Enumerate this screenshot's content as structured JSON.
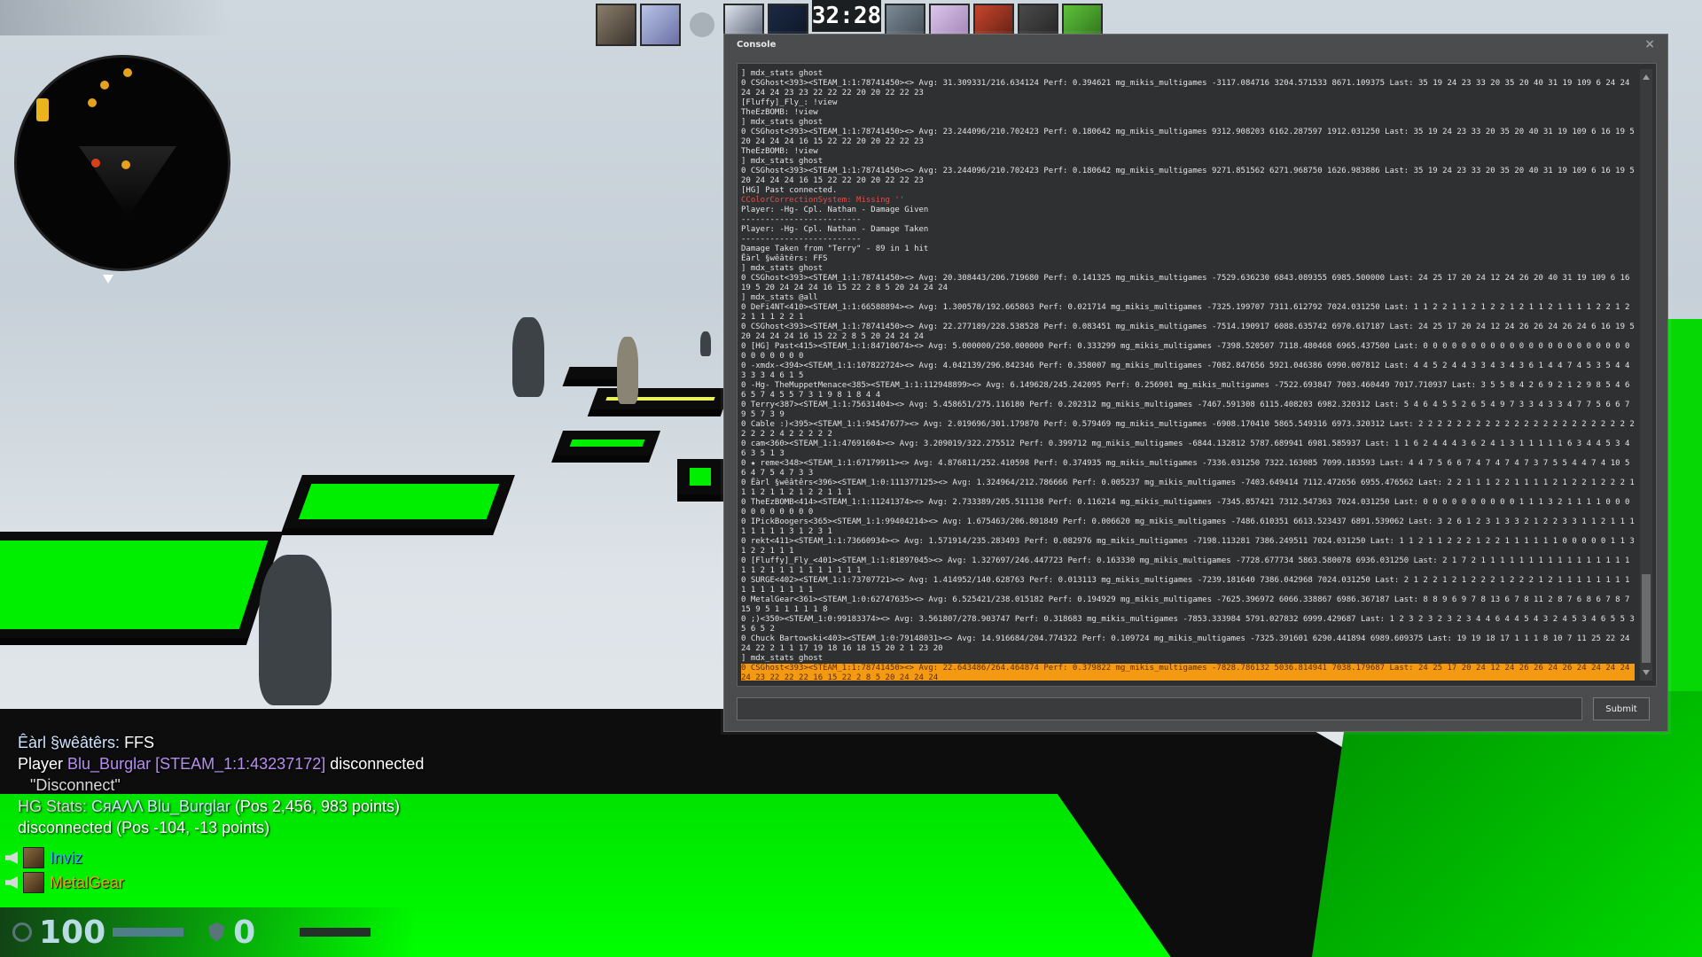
{
  "hud_top": {
    "clock": "32:28"
  },
  "console": {
    "title": "Console",
    "close_glyph": "×",
    "submit_label": "Submit",
    "input_value": "",
    "lines": [
      {
        "text": "] mdx_stats ghost",
        "kind": "normal"
      },
      {
        "text": "0 CSGhost<393><STEAM_1:1:78741450><> Avg: 31.309331/216.634124 Perf: 0.394621 mg_mikis_multigames -3117.084716 3204.571533 8671.109375 Last: 35 19 24 23 33 20 35 20 40 31 19 109 6 24 24 24 24 24 23 23 22 22 22 20 20 22 22 23",
        "kind": "normal"
      },
      {
        "text": "[Fluffy]_Fly_: !view",
        "kind": "normal"
      },
      {
        "text": "TheEzBOMB: !view",
        "kind": "normal"
      },
      {
        "text": "] mdx_stats ghost",
        "kind": "normal"
      },
      {
        "text": "0 CSGhost<393><STEAM_1:1:78741450><> Avg: 23.244096/210.702423 Perf: 0.180642 mg_mikis_multigames 9312.908203 6162.287597 1912.031250 Last: 35 19 24 23 33 20 35 20 40 31 19 109 6 16 19 5 20 24 24 24 16 15 22 22 20 20 22 22 23",
        "kind": "normal"
      },
      {
        "text": "TheEzBOMB: !view",
        "kind": "normal"
      },
      {
        "text": "] mdx_stats ghost",
        "kind": "normal"
      },
      {
        "text": "0 CSGhost<393><STEAM_1:1:78741450><> Avg: 23.244096/210.702423 Perf: 0.180642 mg_mikis_multigames 9271.851562 6271.968750 1626.983886 Last: 35 19 24 23 33 20 35 20 40 31 19 109 6 16 19 5 20 24 24 24 16 15 22 22 20 20 22 22 23",
        "kind": "normal"
      },
      {
        "text": "[HG] Past connected.",
        "kind": "normal"
      },
      {
        "text": "CColorCorrectionSystem: Missing ''",
        "kind": "err"
      },
      {
        "text": "Player: -Hg- Cpl. Nathan - Damage Given",
        "kind": "normal"
      },
      {
        "text": "-------------------------",
        "kind": "normal"
      },
      {
        "text": "Player: -Hg- Cpl. Nathan - Damage Taken",
        "kind": "normal"
      },
      {
        "text": "-------------------------",
        "kind": "normal"
      },
      {
        "text": "Damage Taken from \"Terry\" - 89 in 1 hit",
        "kind": "normal"
      },
      {
        "text": "Êàrl §wêâtêrs: FFS",
        "kind": "normal"
      },
      {
        "text": "] mdx_stats ghost",
        "kind": "normal"
      },
      {
        "text": "0 CSGhost<393><STEAM_1:1:78741450><> Avg: 20.308443/206.719680 Perf: 0.141325 mg_mikis_multigames -7529.636230 6843.089355 6985.500000 Last: 24 25 17 20 24 12 24 26 20 40 31 19 109 6 16 19 5 20 24 24 24 16 15 22 2 8 5 20 24 24 24",
        "kind": "normal"
      },
      {
        "text": "] mdx_stats @all",
        "kind": "normal"
      },
      {
        "text": "0 DeFi4NT<410><STEAM_1:1:66588894><> Avg: 1.300578/192.665863 Perf: 0.021714 mg_mikis_multigames -7325.199707 7311.612792 7024.031250 Last: 1 1 2 2 1 1 2 1 2 2 1 2 1 1 2 1 1 1 1 2 2 1 2 2 1 1 1 2 2 1",
        "kind": "normal"
      },
      {
        "text": "0 CSGhost<393><STEAM_1:1:78741450><> Avg: 22.277189/228.538528 Perf: 0.083451 mg_mikis_multigames -7514.190917 6088.635742 6970.617187 Last: 24 25 17 20 24 12 24 26 26 24 26 24 6 16 19 5 20 24 24 24 16 15 22 2 8 5 20 24 24 24",
        "kind": "normal"
      },
      {
        "text": "0 [HG] Past<415><STEAM_1:1:84710674><> Avg: 5.000000/250.000000 Perf: 0.333299 mg_mikis_multigames -7398.520507 7118.480468 6965.437500 Last: 0 0 0 0 0 0 0 0 0 0 0 0 0 0 0 0 0 0 0 0 0 0 0 0 0 0 0 0 0",
        "kind": "normal"
      },
      {
        "text": "0 -xmdx-<394><STEAM_1:1:107822724><> Avg: 4.042139/296.842346 Perf: 0.358007 mg_mikis_multigames -7082.847656 5921.046386 6990.007812 Last: 4 4 5 2 4 4 3 3 4 3 4 3 6 1 4 4 7 4 5 3 5 4 4 3 3 3 4 6 1 5",
        "kind": "normal"
      },
      {
        "text": "0 -Hg- TheMuppetMenace<385><STEAM_1:1:112948899><> Avg: 6.149628/245.242095 Perf: 0.256901 mg_mikis_multigames -7522.693847 7003.460449 7017.710937 Last: 3 5 5 8 4 2 6 9 2 1 2 9 8 5 4 6 6 5 7 4 5 5 7 3 1 9 8 1 8 4 4",
        "kind": "normal"
      },
      {
        "text": "0 Terry<387><STEAM_1:1:75631404><> Avg: 5.458651/275.116180 Perf: 0.202312 mg_mikis_multigames -7467.591308 6115.408203 6982.320312 Last: 5 4 6 4 5 5 2 6 5 4 9 7 3 3 4 3 3 4 7 7 5 6 6 7 9 5 7 3 9",
        "kind": "normal"
      },
      {
        "text": "0 Cable :)<395><STEAM_1:1:94547677><> Avg: 2.019696/301.179870 Perf: 0.579469 mg_mikis_multigames -6908.170410 5865.549316 6973.320312 Last: 2 2 2 2 2 2 2 2 2 2 2 2 2 2 2 2 2 2 2 2 2 2 2 2 2 2 2 4 2 2 2 2 2",
        "kind": "normal"
      },
      {
        "text": "0 cam<360><STEAM_1:1:47691604><> Avg: 3.209019/322.275512 Perf: 0.399712 mg_mikis_multigames -6844.132812 5787.689941 6981.585937 Last: 1 1 6 2 4 4 4 3 6 2 4 1 3 1 1 1 1 1 6 3 4 4 5 3 4 6 3 5 1 3",
        "kind": "normal"
      },
      {
        "text": "0 ★ reme<348><STEAM_1:1:67179911><> Avg: 4.876811/252.410598 Perf: 0.374935 mg_mikis_multigames -7336.031250 7322.163085 7099.183593 Last: 4 4 7 5 6 6 7 4 7 4 7 4 7 3 7 5 5 4 4 7 4 10 5 6 4 7 5 4 7 3 3",
        "kind": "normal"
      },
      {
        "text": "0 Êàrl §wêâtêrs<396><STEAM_1:0:111377125><> Avg: 1.324964/212.786666 Perf: 0.005237 mg_mikis_multigames -7403.649414 7112.472656 6955.476562 Last: 2 2 1 1 1 2 2 1 1 1 1 2 1 2 2 1 2 2 2 1 1 1 2 1 1 2 1 2 2 1 1 1",
        "kind": "normal"
      },
      {
        "text": "0 TheEzBOMB<414><STEAM_1:1:11241374><> Avg: 2.733389/205.511138 Perf: 0.116214 mg_mikis_multigames -7345.857421 7312.547363 7024.031250 Last: 0 0 0 0 0 0 0 0 0 0 1 1 1 3 2 1 1 1 1 0 0 0 0 0 0 0 0 0 0 0",
        "kind": "normal"
      },
      {
        "text": "0 IPickBoogers<365><STEAM_1:1:99404214><> Avg: 1.675463/206.801849 Perf: 0.006620 mg_mikis_multigames -7486.610351 6613.523437 6891.539062 Last: 3 2 6 1 2 3 1 3 3 2 1 2 2 3 3 1 1 2 1 1 1 1 1 1 1 1 3 1 2 3 1",
        "kind": "normal"
      },
      {
        "text": "0 rekt<411><STEAM_1:1:73660934><> Avg: 1.571914/235.283493 Perf: 0.082976 mg_mikis_multigames -7198.113281 7386.249511 7024.031250 Last: 1 1 2 1 1 2 2 2 1 2 2 1 1 1 1 1 1 0 0 0 0 0 1 1 3 1 2 2 1 1 1",
        "kind": "normal"
      },
      {
        "text": "0 [Fluffy]_Fly_<401><STEAM_1:1:81897045><> Avg: 1.327697/246.447723 Perf: 0.163330 mg_mikis_multigames -7728.677734 5863.580078 6936.031250 Last: 2 1 7 2 1 1 1 1 1 1 1 1 1 1 1 1 1 1 1 1 1 1 2 1 1 1 1 1 1 1 1 1 1",
        "kind": "normal"
      },
      {
        "text": "0 SURGE<402><STEAM_1:1:73707721><> Avg: 1.414952/140.628763 Perf: 0.013113 mg_mikis_multigames -7239.181640 7386.042968 7024.031250 Last: 2 1 2 2 1 2 1 2 2 2 1 2 2 2 1 2 1 1 1 1 1 1 1 1 1 1 1 1 1 1 1 1",
        "kind": "normal"
      },
      {
        "text": "0 MetalGear<361><STEAM_1:0:62747635><> Avg: 6.525421/238.015182 Perf: 0.194929 mg_mikis_multigames -7625.396972 6066.338867 6986.367187 Last: 8 8 9 6 9 7 8 13 6 7 8 11 2 8 7 6 8 6 7 8 7 15 9 5 1 1 1 1 1 8",
        "kind": "normal"
      },
      {
        "text": "0 ;)<350><STEAM_1:0:99183374><> Avg: 3.561807/278.903747 Perf: 0.318683 mg_mikis_multigames -7853.333984 5791.027832 6999.429687 Last: 1 2 3 2 3 2 3 2 3 4 4 6 4 4 5 4 3 2 4 5 3 4 6 5 5 3 5 6 5 2",
        "kind": "normal"
      },
      {
        "text": "0 Chuck Bartowski<403><STEAM_1:0:79148031><> Avg: 14.916684/204.774322 Perf: 0.109724 mg_mikis_multigames -7325.391601 6290.441894 6989.609375 Last: 19 19 18 17 1 1 1 8 10 7 11 25 22 24 24 22 2 1 1 17 19 18 16 18 15 20 2 1 23 20",
        "kind": "normal"
      },
      {
        "text": "] mdx_stats ghost",
        "kind": "normal"
      },
      {
        "text": "0 CSGhost<393><STEAM_1:1:78741450><> Avg: 22.643486/264.464874 Perf: 0.379822 mg_mikis_multigames -7828.786132 5036.814941 7038.179687 Last: 24 25 17 20 24 12 24 26 26 24 26 24 24 24 24 24 23 22 22 22 16 15 22 2 8 5 20 24 24 24",
        "kind": "hl"
      }
    ]
  },
  "chat": {
    "line1_name": "Êàrl §wêâtêrs:",
    "line1_msg": " FFS",
    "line2_prefix": "Player ",
    "line2_name": "Blu_Burglar",
    "line2_steam": "[STEAM_1:1:43237172]",
    "line2_suffix": " disconnected",
    "line3_quote": "\"Disconnect\"",
    "line4_prefix": "HG Stats: ",
    "line4_name": "CяAΛΛ Blu_Burglar",
    "line4_suffix": " (Pos 2,456, 983 points)",
    "line5": "disconnected (Pos -104, -13 points)"
  },
  "voice": {
    "speaker1": "Inviz",
    "speaker2": "MetalGear"
  },
  "hud_bottom": {
    "health": "100",
    "armor": "0",
    "health_fill": 1.0,
    "armor_fill": 0.0
  },
  "colors": {
    "highlight": "#f39a12",
    "error": "#e05050",
    "floor_green": "#00ff00"
  }
}
